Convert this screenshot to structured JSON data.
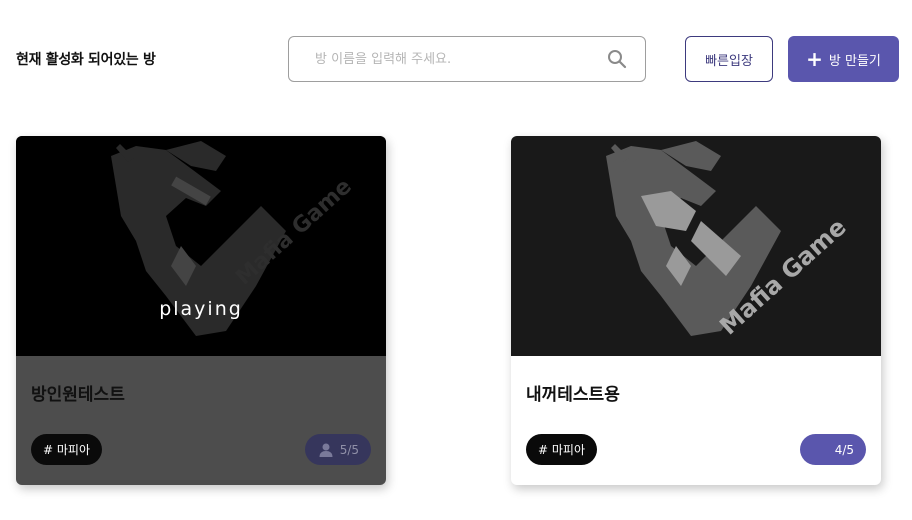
{
  "header": {
    "title": "현재 활성화 되어있는 방",
    "search_placeholder": "방 이름을 입력해 주세요.",
    "quick_join_label": "빠른입장",
    "create_room_label": "방 만들기"
  },
  "rooms": [
    {
      "name": "방인원테스트",
      "status_overlay": "playing",
      "tag": "# 마피아",
      "players": "5/5",
      "logo_text": "Mafia Game"
    },
    {
      "name": "내꺼테스트용",
      "status_overlay": "",
      "tag": "# 마피아",
      "players": "4/5",
      "logo_text": "Mafia Game"
    }
  ],
  "colors": {
    "accent": "#5a56ad",
    "accent_dark": "#3d3a7e",
    "playing_card_bg": "#4d4d4d",
    "tag_bg": "#0a0a0a"
  },
  "icons": [
    "search-icon",
    "plus-icon",
    "user-icon",
    "mafia-logo"
  ]
}
